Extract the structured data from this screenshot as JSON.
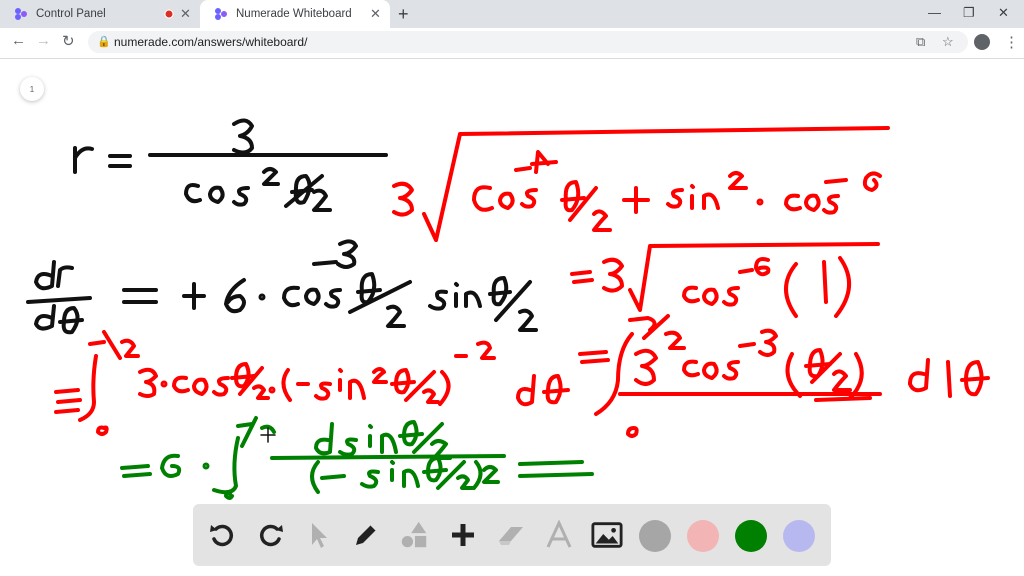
{
  "browser": {
    "tabs": [
      {
        "title": "Control Panel",
        "active": false
      },
      {
        "title": "Numerade Whiteboard",
        "active": true
      }
    ],
    "url": "numerade.com/answers/whiteboard/"
  },
  "whiteboard": {
    "page_number": "1"
  },
  "toolbar": {
    "colors": [
      "#a6a6a6",
      "#f2b4b4",
      "#008000",
      "#b8b8f0"
    ]
  }
}
